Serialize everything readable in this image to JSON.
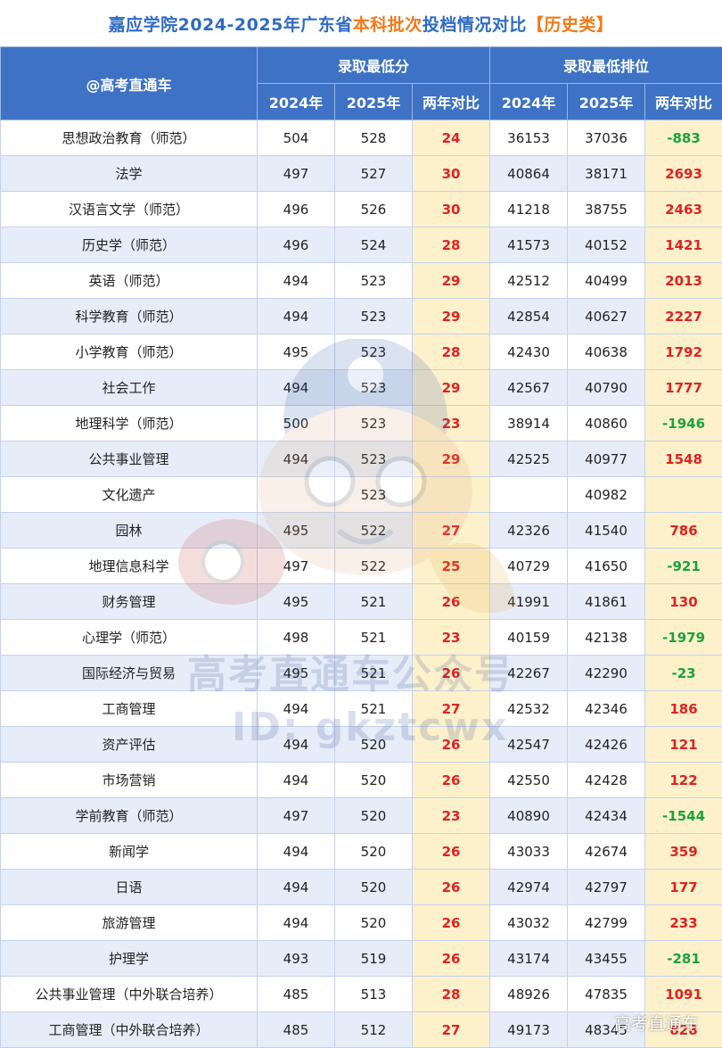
{
  "title": {
    "part1": "嘉应学院2024-2025年广东省",
    "part2": "本科批次",
    "part3": "投档情况对比",
    "part4": "【历史类】"
  },
  "header": {
    "corner": "@高考直通车",
    "score_group": "录取最低分",
    "rank_group": "录取最低排位",
    "y2024": "2024年",
    "y2025": "2025年",
    "compare": "两年对比"
  },
  "rows": [
    {
      "name": "思想政治教育（师范）",
      "s2024": "504",
      "s2025": "528",
      "sdiff": "24",
      "r2024": "36153",
      "r2025": "37036",
      "rdiff": "-883"
    },
    {
      "name": "法学",
      "s2024": "497",
      "s2025": "527",
      "sdiff": "30",
      "r2024": "40864",
      "r2025": "38171",
      "rdiff": "2693"
    },
    {
      "name": "汉语言文学（师范）",
      "s2024": "496",
      "s2025": "526",
      "sdiff": "30",
      "r2024": "41218",
      "r2025": "38755",
      "rdiff": "2463"
    },
    {
      "name": "历史学（师范）",
      "s2024": "496",
      "s2025": "524",
      "sdiff": "28",
      "r2024": "41573",
      "r2025": "40152",
      "rdiff": "1421"
    },
    {
      "name": "英语（师范）",
      "s2024": "494",
      "s2025": "523",
      "sdiff": "29",
      "r2024": "42512",
      "r2025": "40499",
      "rdiff": "2013"
    },
    {
      "name": "科学教育（师范）",
      "s2024": "494",
      "s2025": "523",
      "sdiff": "29",
      "r2024": "42854",
      "r2025": "40627",
      "rdiff": "2227"
    },
    {
      "name": "小学教育（师范）",
      "s2024": "495",
      "s2025": "523",
      "sdiff": "28",
      "r2024": "42430",
      "r2025": "40638",
      "rdiff": "1792"
    },
    {
      "name": "社会工作",
      "s2024": "494",
      "s2025": "523",
      "sdiff": "29",
      "r2024": "42567",
      "r2025": "40790",
      "rdiff": "1777"
    },
    {
      "name": "地理科学（师范）",
      "s2024": "500",
      "s2025": "523",
      "sdiff": "23",
      "r2024": "38914",
      "r2025": "40860",
      "rdiff": "-1946"
    },
    {
      "name": "公共事业管理",
      "s2024": "494",
      "s2025": "523",
      "sdiff": "29",
      "r2024": "42525",
      "r2025": "40977",
      "rdiff": "1548"
    },
    {
      "name": "文化遗产",
      "s2024": "",
      "s2025": "523",
      "sdiff": "",
      "r2024": "",
      "r2025": "40982",
      "rdiff": ""
    },
    {
      "name": "园林",
      "s2024": "495",
      "s2025": "522",
      "sdiff": "27",
      "r2024": "42326",
      "r2025": "41540",
      "rdiff": "786"
    },
    {
      "name": "地理信息科学",
      "s2024": "497",
      "s2025": "522",
      "sdiff": "25",
      "r2024": "40729",
      "r2025": "41650",
      "rdiff": "-921"
    },
    {
      "name": "财务管理",
      "s2024": "495",
      "s2025": "521",
      "sdiff": "26",
      "r2024": "41991",
      "r2025": "41861",
      "rdiff": "130"
    },
    {
      "name": "心理学（师范）",
      "s2024": "498",
      "s2025": "521",
      "sdiff": "23",
      "r2024": "40159",
      "r2025": "42138",
      "rdiff": "-1979"
    },
    {
      "name": "国际经济与贸易",
      "s2024": "495",
      "s2025": "521",
      "sdiff": "26",
      "r2024": "42267",
      "r2025": "42290",
      "rdiff": "-23"
    },
    {
      "name": "工商管理",
      "s2024": "494",
      "s2025": "521",
      "sdiff": "27",
      "r2024": "42532",
      "r2025": "42346",
      "rdiff": "186"
    },
    {
      "name": "资产评估",
      "s2024": "494",
      "s2025": "520",
      "sdiff": "26",
      "r2024": "42547",
      "r2025": "42426",
      "rdiff": "121"
    },
    {
      "name": "市场营销",
      "s2024": "494",
      "s2025": "520",
      "sdiff": "26",
      "r2024": "42550",
      "r2025": "42428",
      "rdiff": "122"
    },
    {
      "name": "学前教育（师范）",
      "s2024": "497",
      "s2025": "520",
      "sdiff": "23",
      "r2024": "40890",
      "r2025": "42434",
      "rdiff": "-1544"
    },
    {
      "name": "新闻学",
      "s2024": "494",
      "s2025": "520",
      "sdiff": "26",
      "r2024": "43033",
      "r2025": "42674",
      "rdiff": "359"
    },
    {
      "name": "日语",
      "s2024": "494",
      "s2025": "520",
      "sdiff": "26",
      "r2024": "42974",
      "r2025": "42797",
      "rdiff": "177"
    },
    {
      "name": "旅游管理",
      "s2024": "494",
      "s2025": "520",
      "sdiff": "26",
      "r2024": "43032",
      "r2025": "42799",
      "rdiff": "233"
    },
    {
      "name": "护理学",
      "s2024": "493",
      "s2025": "519",
      "sdiff": "26",
      "r2024": "43174",
      "r2025": "43455",
      "rdiff": "-281"
    },
    {
      "name": "公共事业管理（中外联合培养）",
      "s2024": "485",
      "s2025": "513",
      "sdiff": "28",
      "r2024": "48926",
      "r2025": "47835",
      "rdiff": "1091"
    },
    {
      "name": "工商管理（中外联合培养）",
      "s2024": "485",
      "s2025": "512",
      "sdiff": "27",
      "r2024": "49173",
      "r2025": "48345",
      "rdiff": "828"
    }
  ],
  "watermark": {
    "line1": "高考直通车公众号",
    "line2": "ID: gkztcwx",
    "logo_char": "高"
  },
  "corner_mark": "高考直通车",
  "colors": {
    "header_bg": "#3e72c4",
    "title_blue": "#2f6bc4",
    "title_orange": "#f07a1a",
    "positive": "#e02222",
    "negative": "#1aa33a",
    "highlight_bg": "#fdf1cc",
    "stripe_bg": "#e7edf8"
  }
}
